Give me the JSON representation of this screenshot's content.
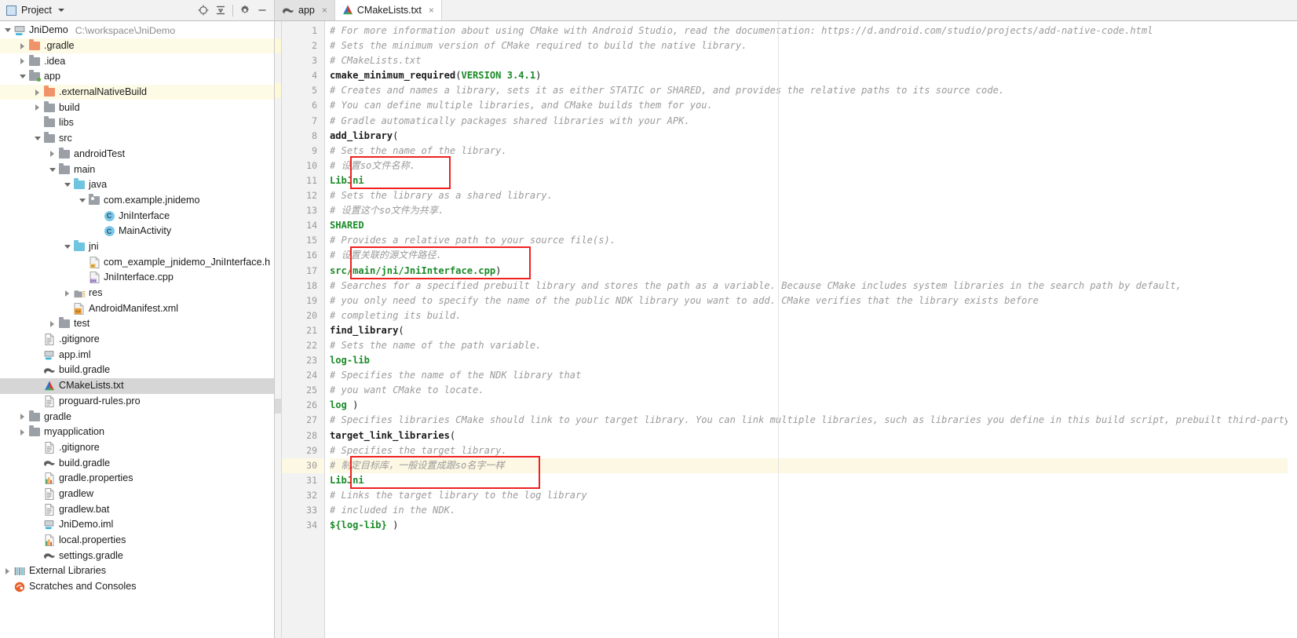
{
  "toolbar": {
    "project_label": "Project",
    "icons": [
      {
        "name": "locate-icon",
        "glyph": "target"
      },
      {
        "name": "collapse-all-icon",
        "glyph": "collapse"
      },
      {
        "name": "settings-gear-icon",
        "glyph": "gear"
      },
      {
        "name": "hide-icon",
        "glyph": "minus"
      }
    ]
  },
  "tabs": [
    {
      "label": "app",
      "icon": "gradle-icon",
      "active": false,
      "close": "×"
    },
    {
      "label": "CMakeLists.txt",
      "icon": "cmake-icon",
      "active": true,
      "close": "×"
    }
  ],
  "sidebar": {
    "root": {
      "label": "JniDemo",
      "path": "C:\\workspace\\JniDemo"
    },
    "items": [
      {
        "label": "JniDemo",
        "note": "C:\\workspace\\JniDemo",
        "indent": 0,
        "arrow": "down",
        "icon": "module-icon",
        "state": "normal"
      },
      {
        "label": ".gradle",
        "indent": 1,
        "arrow": "right",
        "icon": "folder-orange-icon",
        "state": "highlight"
      },
      {
        "label": ".idea",
        "indent": 1,
        "arrow": "right",
        "icon": "folder-gray-icon",
        "state": "normal"
      },
      {
        "label": "app",
        "indent": 1,
        "arrow": "down",
        "icon": "module-folder-icon",
        "state": "normal"
      },
      {
        "label": ".externalNativeBuild",
        "indent": 2,
        "arrow": "right",
        "icon": "folder-orange-icon",
        "state": "highlight"
      },
      {
        "label": "build",
        "indent": 2,
        "arrow": "right",
        "icon": "folder-gray-icon",
        "state": "normal"
      },
      {
        "label": "libs",
        "indent": 2,
        "arrow": "none",
        "icon": "folder-gray-icon",
        "state": "normal"
      },
      {
        "label": "src",
        "indent": 2,
        "arrow": "down",
        "icon": "folder-gray-icon",
        "state": "normal"
      },
      {
        "label": "androidTest",
        "indent": 3,
        "arrow": "right",
        "icon": "folder-gray-icon",
        "state": "normal"
      },
      {
        "label": "main",
        "indent": 3,
        "arrow": "down",
        "icon": "folder-gray-icon",
        "state": "normal"
      },
      {
        "label": "java",
        "indent": 4,
        "arrow": "down",
        "icon": "folder-blue-icon",
        "state": "normal"
      },
      {
        "label": "com.example.jnidemo",
        "indent": 5,
        "arrow": "down",
        "icon": "package-icon",
        "state": "normal"
      },
      {
        "label": "JniInterface",
        "indent": 6,
        "arrow": "none",
        "icon": "java-class-icon",
        "state": "normal"
      },
      {
        "label": "MainActivity",
        "indent": 6,
        "arrow": "none",
        "icon": "java-class-icon",
        "state": "normal"
      },
      {
        "label": "jni",
        "indent": 4,
        "arrow": "down",
        "icon": "folder-blue-icon",
        "state": "normal"
      },
      {
        "label": "com_example_jnidemo_JniInterface.h",
        "indent": 5,
        "arrow": "none",
        "icon": "header-file-icon",
        "state": "normal"
      },
      {
        "label": "JniInterface.cpp",
        "indent": 5,
        "arrow": "none",
        "icon": "cpp-file-icon",
        "state": "normal"
      },
      {
        "label": "res",
        "indent": 4,
        "arrow": "right",
        "icon": "res-folder-icon",
        "state": "normal"
      },
      {
        "label": "AndroidManifest.xml",
        "indent": 4,
        "arrow": "none",
        "icon": "xml-file-icon",
        "state": "normal"
      },
      {
        "label": "test",
        "indent": 3,
        "arrow": "right",
        "icon": "folder-gray-icon",
        "state": "normal"
      },
      {
        "label": ".gitignore",
        "indent": 2,
        "arrow": "none",
        "icon": "text-file-icon",
        "state": "normal"
      },
      {
        "label": "app.iml",
        "indent": 2,
        "arrow": "none",
        "icon": "iml-file-icon",
        "state": "normal"
      },
      {
        "label": "build.gradle",
        "indent": 2,
        "arrow": "none",
        "icon": "gradle-file-icon",
        "state": "normal"
      },
      {
        "label": "CMakeLists.txt",
        "indent": 2,
        "arrow": "none",
        "icon": "cmake-file-icon",
        "state": "selected"
      },
      {
        "label": "proguard-rules.pro",
        "indent": 2,
        "arrow": "none",
        "icon": "text-file-icon",
        "state": "normal"
      },
      {
        "label": "gradle",
        "indent": 1,
        "arrow": "right",
        "icon": "folder-gray-icon",
        "state": "normal"
      },
      {
        "label": "myapplication",
        "indent": 1,
        "arrow": "right",
        "icon": "folder-gray-icon",
        "state": "normal"
      },
      {
        "label": ".gitignore",
        "indent": 2,
        "arrow": "none",
        "icon": "text-file-icon",
        "state": "normal"
      },
      {
        "label": "build.gradle",
        "indent": 2,
        "arrow": "none",
        "icon": "gradle-file-icon",
        "state": "normal"
      },
      {
        "label": "gradle.properties",
        "indent": 2,
        "arrow": "none",
        "icon": "properties-file-icon",
        "state": "normal"
      },
      {
        "label": "gradlew",
        "indent": 2,
        "arrow": "none",
        "icon": "text-file-icon",
        "state": "normal"
      },
      {
        "label": "gradlew.bat",
        "indent": 2,
        "arrow": "none",
        "icon": "text-file-icon",
        "state": "normal"
      },
      {
        "label": "JniDemo.iml",
        "indent": 2,
        "arrow": "none",
        "icon": "iml-file-icon",
        "state": "normal"
      },
      {
        "label": "local.properties",
        "indent": 2,
        "arrow": "none",
        "icon": "properties-file-icon",
        "state": "normal"
      },
      {
        "label": "settings.gradle",
        "indent": 2,
        "arrow": "none",
        "icon": "gradle-file-icon",
        "state": "normal"
      },
      {
        "label": "External Libraries",
        "indent": 0,
        "arrow": "right",
        "icon": "external-libraries-icon",
        "state": "normal"
      },
      {
        "label": "Scratches and Consoles",
        "indent": 0,
        "arrow": "none",
        "icon": "scratches-icon",
        "state": "normal"
      }
    ]
  },
  "editor": {
    "file": "CMakeLists.txt",
    "first_line": 1,
    "last_line": 34,
    "highlighted_lines": [
      30
    ],
    "gutter_marks": [
      {
        "line": 2,
        "color": "#fdf8d7"
      },
      {
        "line": 5,
        "color": "#fdf8d7"
      },
      {
        "line": 26,
        "color": "#dadada"
      }
    ],
    "red_boxes": [
      {
        "name": "annotation-box-library-name",
        "from_line": 10,
        "to_line": 11
      },
      {
        "name": "annotation-box-source-path",
        "from_line": 16,
        "to_line": 17
      },
      {
        "name": "annotation-box-target-library",
        "from_line": 30,
        "to_line": 31
      }
    ],
    "lines": [
      {
        "n": 1,
        "tokens": [
          {
            "t": "# For more information about using CMake with Android Studio, read the documentation: https://d.android.com/studio/projects/add-native-code.html",
            "c": "cm"
          }
        ]
      },
      {
        "n": 2,
        "tokens": [
          {
            "t": "# Sets the minimum version of CMake required to build the native library.",
            "c": "cm"
          }
        ]
      },
      {
        "n": 3,
        "tokens": [
          {
            "t": "# CMakeLists.txt",
            "c": "cm"
          }
        ]
      },
      {
        "n": 4,
        "tokens": [
          {
            "t": "cmake_minimum_required",
            "c": "kw"
          },
          {
            "t": "(",
            "c": "pl"
          },
          {
            "t": "VERSION 3.4.1",
            "c": "str"
          },
          {
            "t": ")",
            "c": "pl"
          }
        ]
      },
      {
        "n": 5,
        "tokens": [
          {
            "t": "# Creates and names a library, sets it as either STATIC or SHARED, and provides the relative paths to its source code.",
            "c": "cm"
          }
        ]
      },
      {
        "n": 6,
        "tokens": [
          {
            "t": "# You can define multiple libraries, and CMake builds them for you.",
            "c": "cm"
          }
        ]
      },
      {
        "n": 7,
        "tokens": [
          {
            "t": "# Gradle automatically packages shared libraries with your APK.",
            "c": "cm"
          }
        ]
      },
      {
        "n": 8,
        "tokens": [
          {
            "t": "add_library",
            "c": "kw"
          },
          {
            "t": "(",
            "c": "pl"
          }
        ]
      },
      {
        "n": 9,
        "tokens": [
          {
            "t": "# Sets the name of the library.",
            "c": "cm"
          }
        ]
      },
      {
        "n": 10,
        "tokens": [
          {
            "t": "# 设置so文件名称.",
            "c": "cm"
          }
        ]
      },
      {
        "n": 11,
        "tokens": [
          {
            "t": "LibJni",
            "c": "str"
          }
        ]
      },
      {
        "n": 12,
        "tokens": [
          {
            "t": "# Sets the library as a shared library.",
            "c": "cm"
          }
        ]
      },
      {
        "n": 13,
        "tokens": [
          {
            "t": "# 设置这个so文件为共享.",
            "c": "cm"
          }
        ]
      },
      {
        "n": 14,
        "tokens": [
          {
            "t": "SHARED",
            "c": "str"
          }
        ]
      },
      {
        "n": 15,
        "tokens": [
          {
            "t": "# Provides a relative path to your source file(s).",
            "c": "cm"
          }
        ]
      },
      {
        "n": 16,
        "tokens": [
          {
            "t": "# 设置关联的源文件路径.",
            "c": "cm"
          }
        ]
      },
      {
        "n": 17,
        "tokens": [
          {
            "t": "src/main/jni/JniInterface.cpp",
            "c": "str"
          },
          {
            "t": ")",
            "c": "pl"
          }
        ]
      },
      {
        "n": 18,
        "tokens": [
          {
            "t": "# Searches for a specified prebuilt library and stores the path as a variable. Because CMake includes system libraries in the search path by default,",
            "c": "cm"
          }
        ]
      },
      {
        "n": 19,
        "tokens": [
          {
            "t": "# you only need to specify the name of the public NDK library you want to add. CMake verifies that the library exists before",
            "c": "cm"
          }
        ]
      },
      {
        "n": 20,
        "tokens": [
          {
            "t": "# completing its build.",
            "c": "cm"
          }
        ]
      },
      {
        "n": 21,
        "tokens": [
          {
            "t": "find_library",
            "c": "kw"
          },
          {
            "t": "(",
            "c": "pl"
          }
        ]
      },
      {
        "n": 22,
        "tokens": [
          {
            "t": "# Sets the name of the path variable.",
            "c": "cm"
          }
        ]
      },
      {
        "n": 23,
        "tokens": [
          {
            "t": "log-lib",
            "c": "str"
          }
        ]
      },
      {
        "n": 24,
        "tokens": [
          {
            "t": "# Specifies the name of the NDK library that",
            "c": "cm"
          }
        ]
      },
      {
        "n": 25,
        "tokens": [
          {
            "t": "# you want CMake to locate.",
            "c": "cm"
          }
        ]
      },
      {
        "n": 26,
        "tokens": [
          {
            "t": "log",
            "c": "str"
          },
          {
            "t": " )",
            "c": "pl"
          }
        ]
      },
      {
        "n": 27,
        "tokens": [
          {
            "t": "# Specifies libraries CMake should link to your target library. You can link multiple libraries, such as libraries you define in this build script, prebuilt third-party libraries, or system libraries.",
            "c": "cm"
          }
        ]
      },
      {
        "n": 28,
        "tokens": [
          {
            "t": "target_link_libraries",
            "c": "kw"
          },
          {
            "t": "(",
            "c": "pl"
          }
        ]
      },
      {
        "n": 29,
        "tokens": [
          {
            "t": "# Specifies the target library.",
            "c": "cm"
          }
        ]
      },
      {
        "n": 30,
        "tokens": [
          {
            "t": "# 制定目标库，一般设置成跟so名字一样",
            "c": "cm"
          }
        ]
      },
      {
        "n": 31,
        "tokens": [
          {
            "t": "LibJni",
            "c": "str"
          }
        ]
      },
      {
        "n": 32,
        "tokens": [
          {
            "t": "# Links the target library to the log library",
            "c": "cm"
          }
        ]
      },
      {
        "n": 33,
        "tokens": [
          {
            "t": "# included in the NDK.",
            "c": "cm"
          }
        ]
      },
      {
        "n": 34,
        "tokens": [
          {
            "t": "${log-lib}",
            "c": "str"
          },
          {
            "t": " )",
            "c": "pl"
          }
        ]
      }
    ]
  },
  "colors": {
    "string_green": "#1a8b28",
    "comment_gray": "#9b9b9b",
    "annotation_red": "#ef2020",
    "highlight_yellow": "#fdf8e3",
    "selection_gray": "#d6d6d6"
  }
}
